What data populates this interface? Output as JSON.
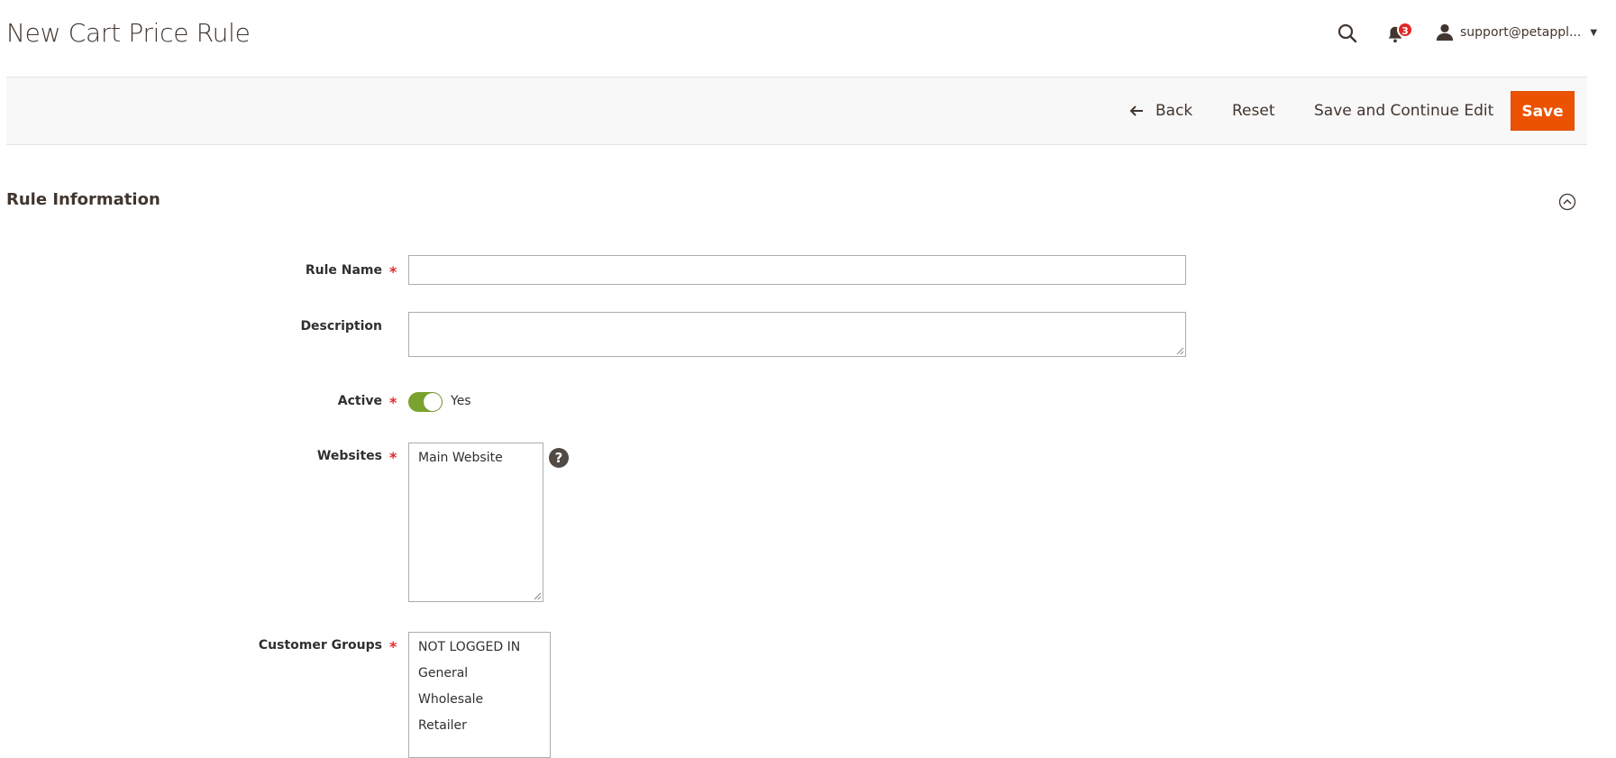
{
  "header": {
    "title": "New Cart Price Rule",
    "notification_count": "3",
    "user_name": "support@petappl..."
  },
  "actions": {
    "back_label": "Back",
    "reset_label": "Reset",
    "save_continue_label": "Save and Continue Edit",
    "save_label": "Save"
  },
  "section": {
    "title": "Rule Information"
  },
  "form": {
    "rule_name": {
      "label": "Rule Name",
      "value": ""
    },
    "description": {
      "label": "Description",
      "value": ""
    },
    "active": {
      "label": "Active",
      "state_label": "Yes"
    },
    "websites": {
      "label": "Websites",
      "options": [
        "Main Website"
      ]
    },
    "customer_groups": {
      "label": "Customer Groups",
      "options": [
        "NOT LOGGED IN",
        "General",
        "Wholesale",
        "Retailer"
      ]
    }
  },
  "colors": {
    "primary_button": "#eb5202",
    "toggle_on": "#79a22e",
    "required": "#e02b27",
    "badge": "#e22626"
  }
}
